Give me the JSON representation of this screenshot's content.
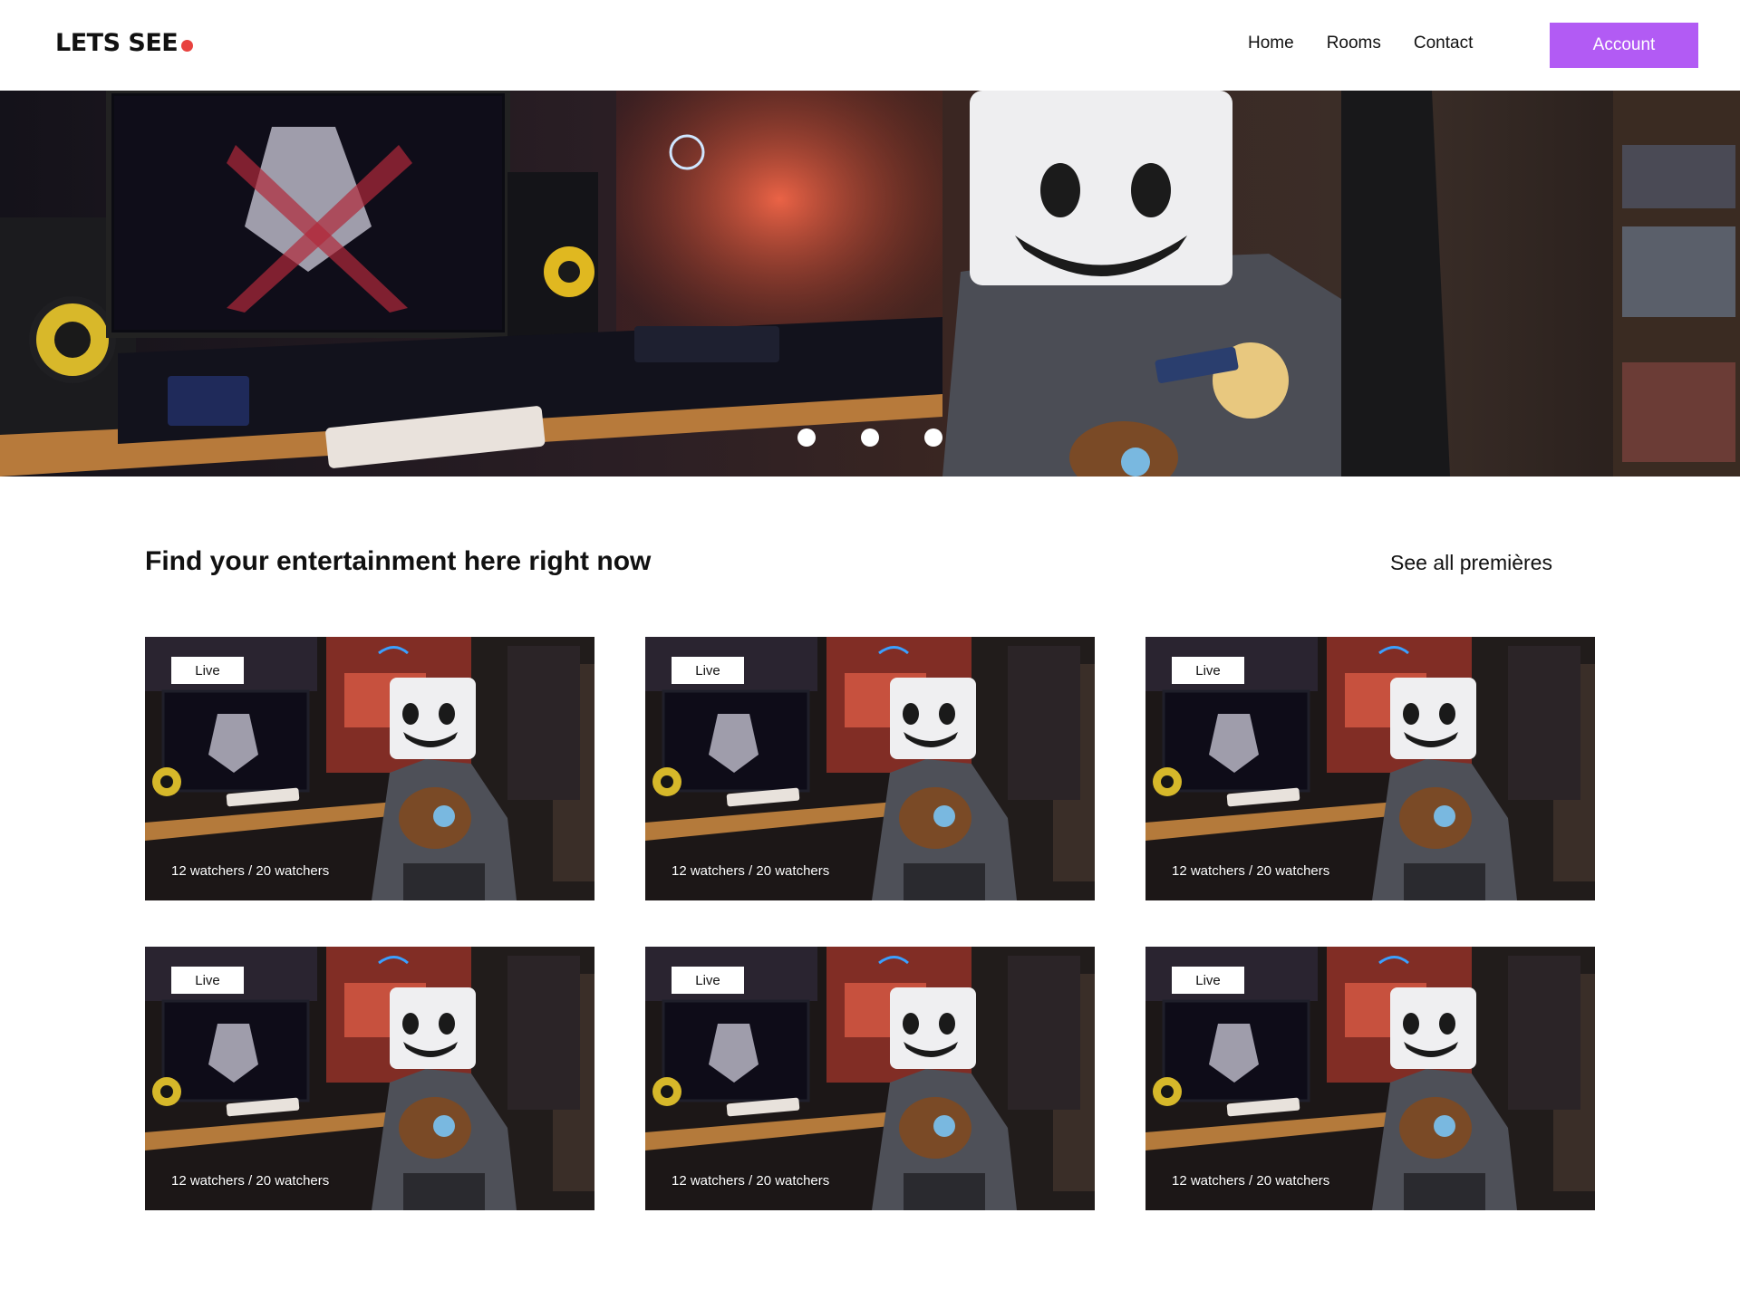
{
  "brand": {
    "name": "LETS SEE",
    "dot_color": "#e8423f"
  },
  "nav": {
    "items": [
      "Home",
      "Rooms",
      "Contact"
    ]
  },
  "account": {
    "label": "Account",
    "color": "#b25bf4"
  },
  "hero": {
    "image": "streamer-setup-marshmello",
    "slides": 3
  },
  "section": {
    "title": "Find your entertainment here right now",
    "see_all": "See all premières"
  },
  "cards": [
    {
      "badge": "Live",
      "watchers": "12 watchers / 20 watchers",
      "image": "streamer-room-thumbnail"
    },
    {
      "badge": "Live",
      "watchers": "12 watchers / 20 watchers",
      "image": "streamer-room-thumbnail"
    },
    {
      "badge": "Live",
      "watchers": "12 watchers / 20 watchers",
      "image": "streamer-room-thumbnail"
    },
    {
      "badge": "Live",
      "watchers": "12 watchers / 20 watchers",
      "image": "streamer-room-thumbnail"
    },
    {
      "badge": "Live",
      "watchers": "12 watchers / 20 watchers",
      "image": "streamer-room-thumbnail"
    },
    {
      "badge": "Live",
      "watchers": "12 watchers / 20 watchers",
      "image": "streamer-room-thumbnail"
    }
  ]
}
